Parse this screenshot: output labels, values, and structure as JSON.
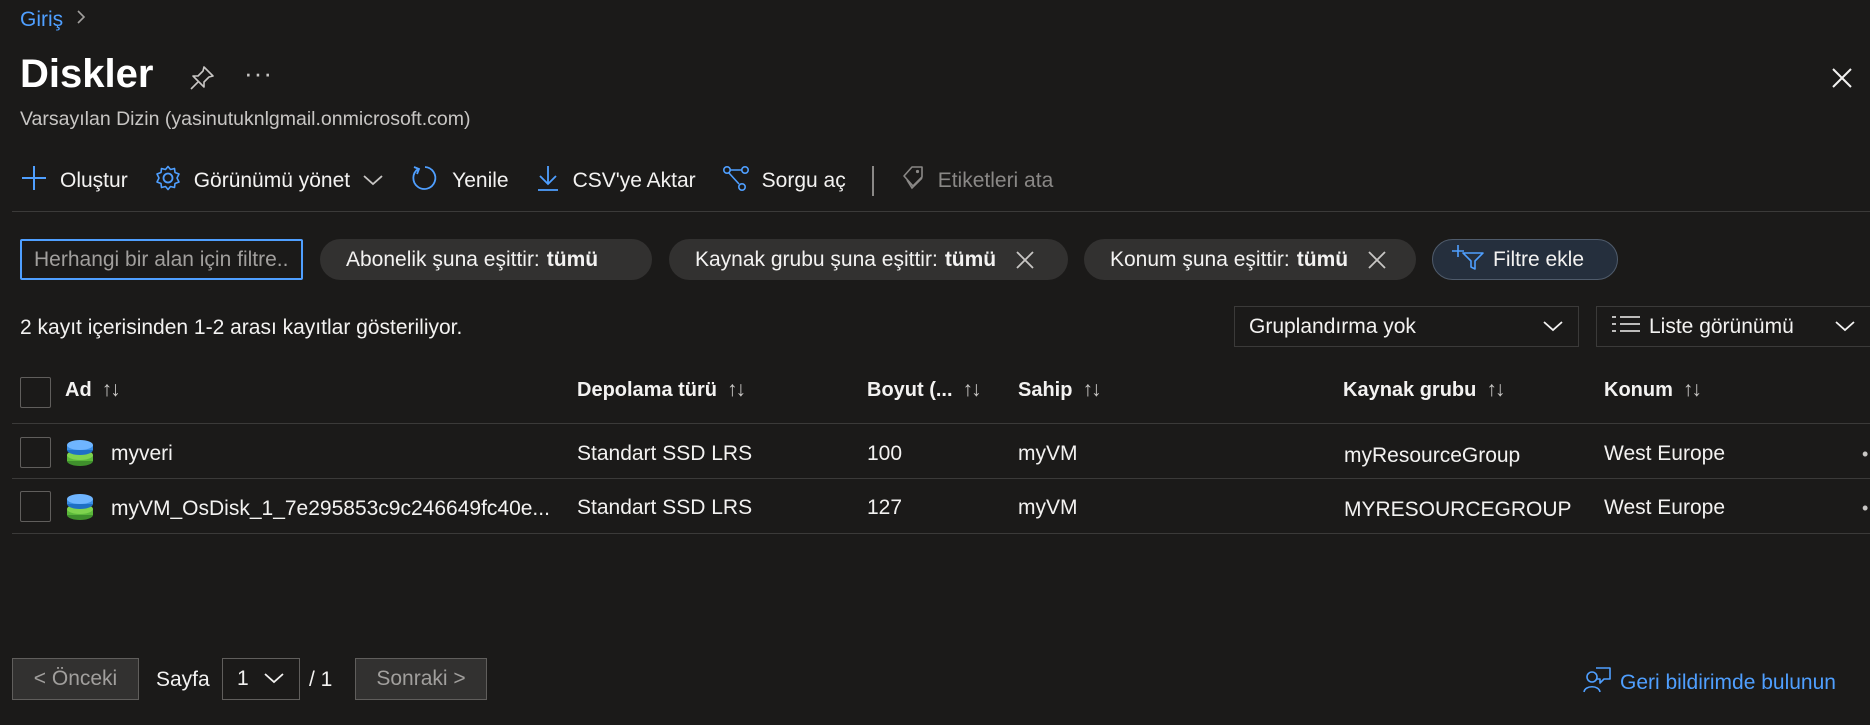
{
  "breadcrumb": {
    "home": "Giriş"
  },
  "header": {
    "title": "Diskler",
    "subtitle": "Varsayılan Dizin (yasinutuknlgmail.onmicrosoft.com)",
    "more": "···"
  },
  "toolbar": {
    "create": "Oluştur",
    "manage_view": "Görünümü yönet",
    "refresh": "Yenile",
    "export_csv": "CSV'ye Aktar",
    "open_query": "Sorgu aç",
    "assign_tags": "Etiketleri ata"
  },
  "filters": {
    "search_placeholder": "Herhangi bir alan için filtre...",
    "subscription_label": "Abonelik şuna eşittir:",
    "subscription_value": "tümü",
    "resource_group_label": "Kaynak grubu şuna eşittir:",
    "resource_group_value": "tümü",
    "location_label": "Konum şuna eşittir:",
    "location_value": "tümü",
    "add_filter": "Filtre ekle"
  },
  "records_text": "2 kayıt içerisinden 1-2 arası kayıtlar gösteriliyor.",
  "grouping": {
    "selected": "Gruplandırma yok"
  },
  "view": {
    "selected": "Liste görünümü"
  },
  "table": {
    "columns": {
      "name": "Ad",
      "storage_type": "Depolama türü",
      "size": "Boyut (...",
      "owner": "Sahip",
      "resource_group": "Kaynak grubu",
      "location": "Konum"
    },
    "rows": [
      {
        "name": "myveri",
        "storage_type": "Standart SSD LRS",
        "size": "100",
        "owner": "myVM",
        "resource_group": "myResourceGroup",
        "location": "West Europe"
      },
      {
        "name": "myVM_OsDisk_1_7e295853c9c246649fc40e...",
        "storage_type": "Standart SSD LRS",
        "size": "127",
        "owner": "myVM",
        "resource_group": "MYRESOURCEGROUP",
        "location": "West Europe"
      }
    ]
  },
  "pagination": {
    "prev": "< Önceki",
    "page_label": "Sayfa",
    "page_value": "1",
    "total": "/ 1",
    "next": "Sonraki >"
  },
  "feedback": "Geri bildirimde bulunun",
  "colors": {
    "accent": "#4f9fff",
    "background": "#1b1a19",
    "pill": "#323130"
  }
}
